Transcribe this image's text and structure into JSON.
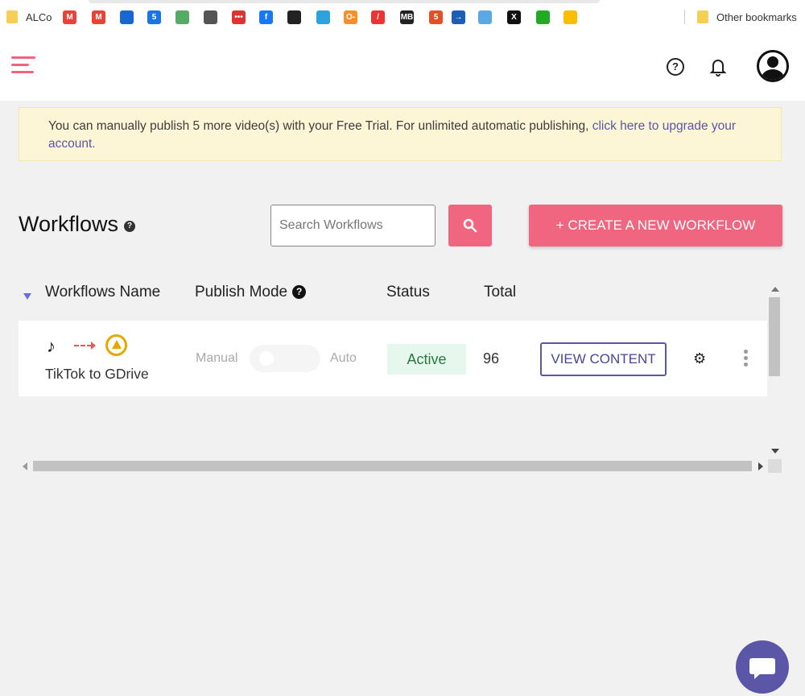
{
  "bookmarks": {
    "first_label": "ALCo",
    "items": [
      {
        "icon": "gmail-icon",
        "glyph": "M",
        "color": "#ea4335"
      },
      {
        "icon": "gmail-icon",
        "glyph": "M",
        "color": "#ea4335"
      },
      {
        "icon": "app-icon",
        "glyph": "",
        "color": "#1967d2"
      },
      {
        "icon": "calendar-icon",
        "glyph": "5",
        "color": "#1a73e8"
      },
      {
        "icon": "headphones-icon",
        "glyph": "",
        "color": "#5a6"
      },
      {
        "icon": "circle-play-icon",
        "glyph": "",
        "color": "#555"
      },
      {
        "icon": "dots-icon",
        "glyph": "•••",
        "color": "#d33"
      },
      {
        "icon": "facebook-icon",
        "glyph": "f",
        "color": "#1877f2"
      },
      {
        "icon": "pen-icon",
        "glyph": "",
        "color": "#222"
      },
      {
        "icon": "telegram-icon",
        "glyph": "",
        "color": "#2aa3df"
      },
      {
        "icon": "key-icon",
        "glyph": "O-",
        "color": "#f7902b"
      },
      {
        "icon": "slash-icon",
        "glyph": "/",
        "color": "#e33"
      },
      {
        "icon": "mb-icon",
        "glyph": "MB",
        "color": "#222"
      },
      {
        "icon": "html5-icon",
        "glyph": "5",
        "color": "#e34f26"
      },
      {
        "icon": "arrow-box-icon",
        "glyph": "→",
        "color": "#1a5fb4"
      },
      {
        "icon": "cloud-icon",
        "glyph": "",
        "color": "#5aa9e6"
      },
      {
        "icon": "x-icon",
        "glyph": "X",
        "color": "#111"
      },
      {
        "icon": "soccer-icon",
        "glyph": "",
        "color": "#2a2"
      },
      {
        "icon": "google-drive-icon",
        "glyph": "",
        "color": "#fbbc04"
      }
    ],
    "other_label": "Other bookmarks"
  },
  "banner": {
    "text": "You can manually publish 5 more video(s) with your Free Trial. For unlimited automatic publishing, ",
    "link": "click here to upgrade your account."
  },
  "workflows": {
    "title": "Workflows",
    "search_placeholder": "Search Workflows",
    "create_label": "+ CREATE A NEW WORKFLOW"
  },
  "table": {
    "headers": {
      "name": "Workflows Name",
      "publish_mode": "Publish Mode",
      "status": "Status",
      "total": "Total"
    },
    "rows": [
      {
        "name": "TikTok to GDrive",
        "manual_label": "Manual",
        "auto_label": "Auto",
        "status": "Active",
        "total": "96",
        "view_label": "VIEW CONTENT"
      }
    ]
  },
  "colors": {
    "accent": "#f0657f",
    "brand": "#5b56a8",
    "status_active_bg": "#e6f7ee",
    "banner_bg": "#fcf6d6"
  }
}
